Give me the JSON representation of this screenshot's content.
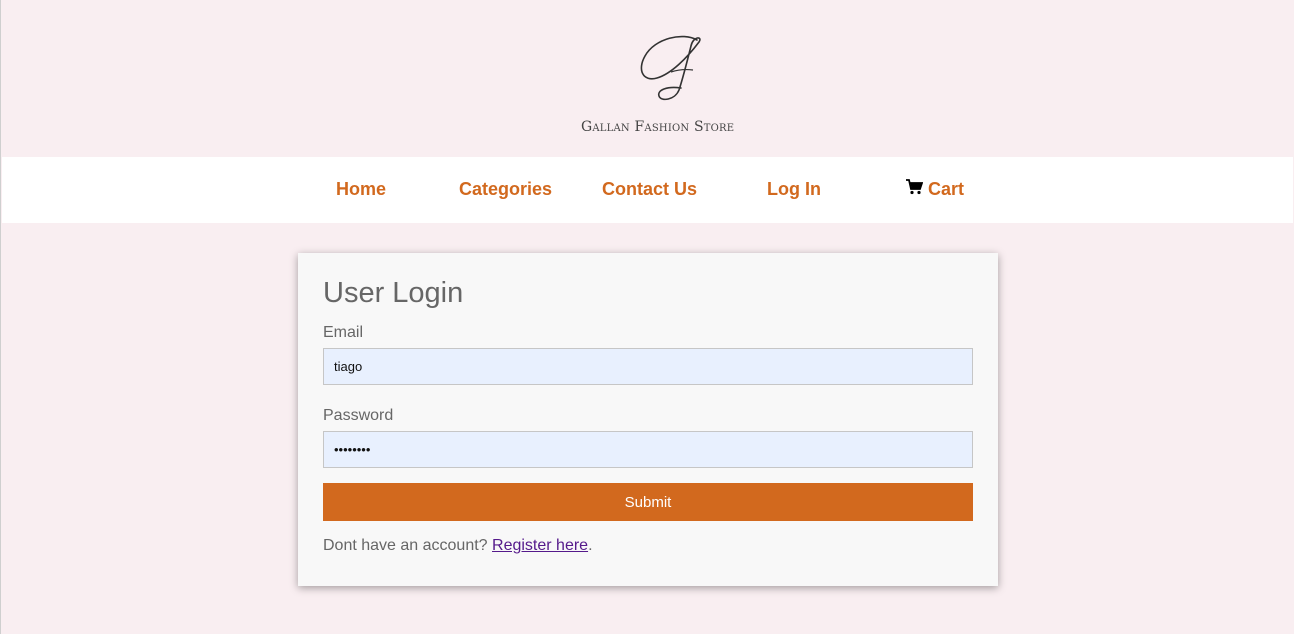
{
  "brand": {
    "name": "Gallan Fashion Store",
    "logo_icon": "script-g-logo-icon"
  },
  "nav": {
    "items": [
      {
        "label": "Home"
      },
      {
        "label": "Categories"
      },
      {
        "label": "Contact Us"
      },
      {
        "label": "Log In"
      },
      {
        "label": "Cart",
        "icon": "shopping-cart-icon"
      }
    ],
    "link_color": "#d2691e"
  },
  "login": {
    "title": "User Login",
    "email_label": "Email",
    "email_value": "tiago",
    "password_label": "Password",
    "password_value": "password",
    "submit_label": "Submit",
    "register_prompt": "Dont have an account?",
    "register_link": "Register here",
    "register_suffix": "."
  },
  "colors": {
    "background": "#f9eef1",
    "accent": "#d2691e",
    "input_bg": "#e8f0fe",
    "card_bg": "#f8f8f8"
  }
}
